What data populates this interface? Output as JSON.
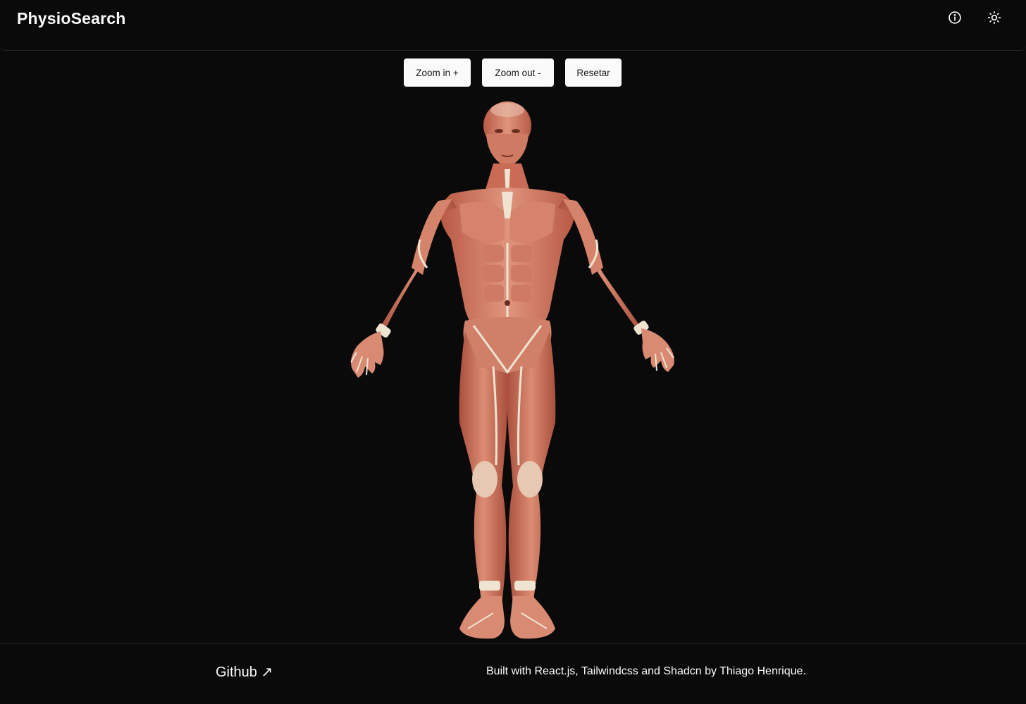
{
  "header": {
    "brand": "PhysioSearch",
    "info_icon": "info-circle-icon",
    "theme_icon": "sun-icon"
  },
  "controls": {
    "zoom_in_label": "Zoom in +",
    "zoom_out_label": "Zoom out -",
    "reset_label": "Resetar"
  },
  "figure": {
    "subject": "anatomical muscle model, anterior view",
    "muscle_color": "#c9705a",
    "tendon_color": "#efe3d2",
    "background": "#0a0a0b"
  },
  "footer": {
    "github_label": "Github ↗",
    "credit": "Built with React.js, Tailwindcss and Shadcn by Thiago Henrique."
  }
}
